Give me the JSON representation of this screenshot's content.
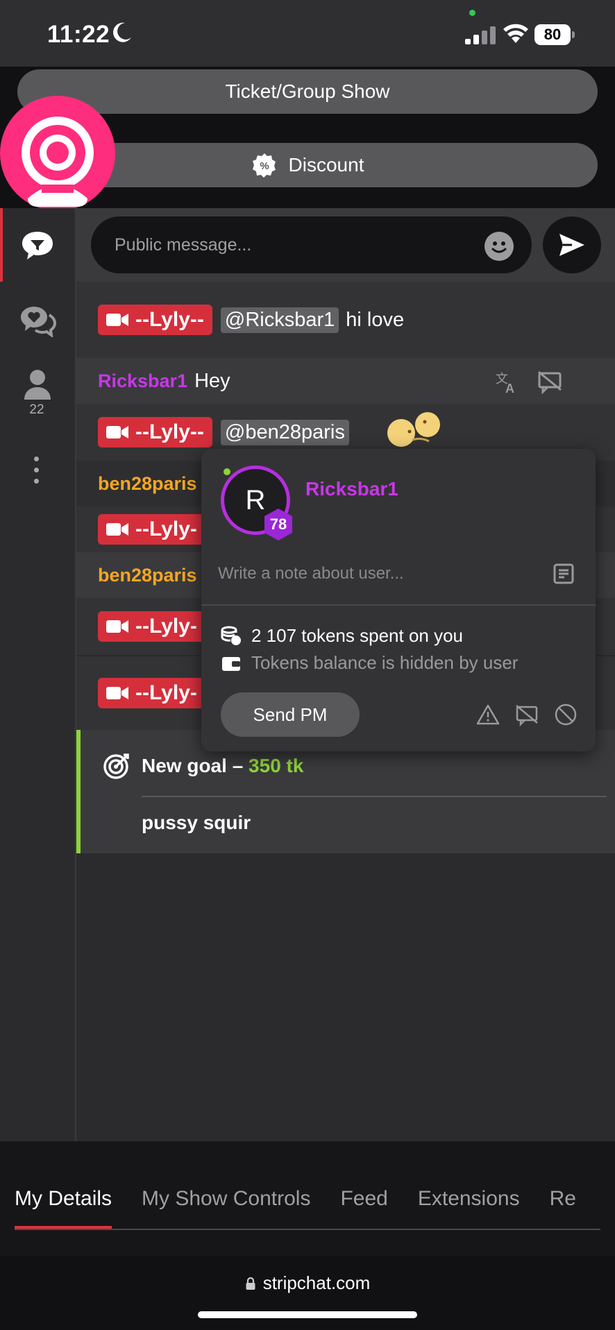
{
  "status_bar": {
    "time": "11:22",
    "battery": "80"
  },
  "top": {
    "ticket_show_label": "Ticket/Group Show",
    "discount_label": "Discount",
    "discount_icon": "%"
  },
  "rail": {
    "viewers_count": "22"
  },
  "composer": {
    "placeholder": "Public message..."
  },
  "chat": {
    "rows": [
      {
        "badge": "--Lyly--",
        "mention": "@Ricksbar1",
        "text": "hi love"
      },
      {
        "user": "Ricksbar1",
        "text": "Hey"
      },
      {
        "badge": "--Lyly--",
        "mention": "@ben28paris"
      },
      {
        "user": "ben28paris"
      },
      {
        "badge": "--Lyly-"
      },
      {
        "user": "ben28paris"
      },
      {
        "badge": "--Lyly-"
      },
      {
        "badge": "--Lyly-"
      }
    ]
  },
  "goal": {
    "title": "New goal –",
    "amount": "350 tk",
    "description": "pussy squir"
  },
  "popup": {
    "avatar_letter": "R",
    "level": "78",
    "username": "Ricksbar1",
    "note_placeholder": "Write a note about user...",
    "tokens_spent": "2 107 tokens spent on you",
    "balance_hidden": "Tokens balance is hidden by user",
    "send_pm_label": "Send PM"
  },
  "tabs": [
    {
      "label": "My Details",
      "active": true
    },
    {
      "label": "My Show Controls",
      "active": false
    },
    {
      "label": "Feed",
      "active": false
    },
    {
      "label": "Extensions",
      "active": false
    },
    {
      "label": "Re",
      "active": false
    }
  ],
  "browser": {
    "url": "stripchat.com"
  },
  "colors": {
    "brand_pink": "#ff2d7d",
    "model_red": "#d52f3c",
    "user_purple": "#c837e8",
    "user_orange": "#f5a623",
    "goal_green": "#8fd23a"
  }
}
